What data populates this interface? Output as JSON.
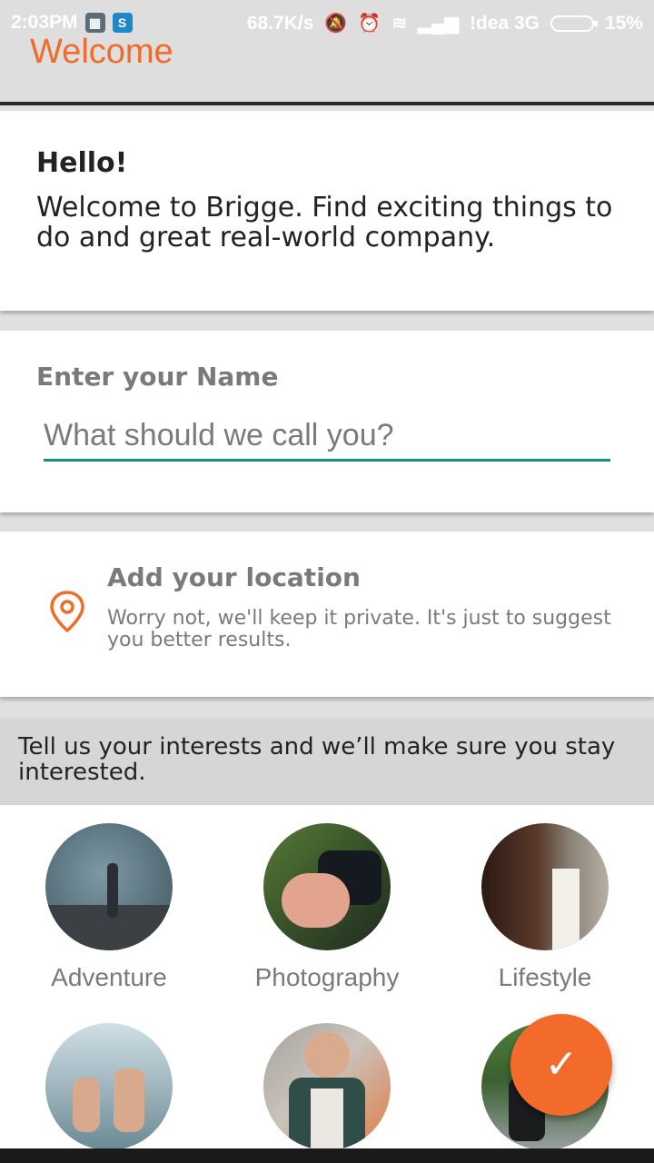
{
  "status_bar": {
    "time": "2:03PM",
    "net_speed": "68.7K/s",
    "carrier": "!dea 3G",
    "battery": "15%"
  },
  "app_bar": {
    "title": "Welcome"
  },
  "hello_card": {
    "title": "Hello!",
    "body": "Welcome to Brigge. Find exciting things to do and great real-world company."
  },
  "name_card": {
    "label": "Enter your Name",
    "input_value": "",
    "input_placeholder": "What should we call you?"
  },
  "location_card": {
    "icon": "map-pin-icon",
    "title": "Add your location",
    "subtitle": "Worry not, we'll keep it private. It's just to suggest you better results."
  },
  "interests": {
    "prompt": "Tell us your interests and we’ll make sure you stay interested.",
    "items": [
      {
        "label": "Adventure"
      },
      {
        "label": "Photography"
      },
      {
        "label": "Lifestyle"
      },
      {
        "label": ""
      },
      {
        "label": ""
      },
      {
        "label": ""
      }
    ]
  },
  "fab": {
    "icon": "check-icon"
  },
  "colors": {
    "accent": "#f26b2a",
    "input_underline": "#15917f",
    "muted_text": "#7a7a7a"
  }
}
